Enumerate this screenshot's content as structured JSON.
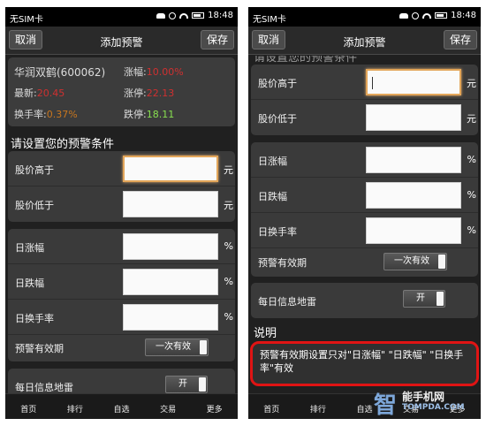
{
  "status_bar": {
    "carrier": "无SIM卡",
    "time": "18:48"
  },
  "header": {
    "cancel_label": "取消",
    "title": "添加预警",
    "save_label": "保存"
  },
  "quote": {
    "name": "华润双鹤(600062)",
    "change_pct_label": "涨幅:",
    "change_pct_value": "10.00%",
    "latest_label": "最新:",
    "latest_value": "20.45",
    "limit_up_label": "涨停:",
    "limit_up_value": "22.13",
    "turnover_label": "换手率:",
    "turnover_value": "0.37%",
    "limit_down_label": "跌停:",
    "limit_down_value": "18.11"
  },
  "conditions": {
    "section_title": "请设置您的预警条件",
    "partial_title": "请设置您的预警条件",
    "price_above": "股价高于",
    "price_below": "股价低于",
    "unit_yuan": "元",
    "daily_rise": "日涨幅",
    "daily_fall": "日跌幅",
    "daily_turnover": "日换手率",
    "unit_pct": "%",
    "validity_label": "预警有效期",
    "validity_value": "一次有效",
    "landmine_label": "每日信息地雷",
    "landmine_value": "开"
  },
  "note": {
    "title": "说明",
    "text": "预警有效期设置只对\"日涨幅\" \"日跌幅\" \"日换手率\"有效"
  },
  "bottom_nav": [
    "首页",
    "排行",
    "自选",
    "交易",
    "更多"
  ],
  "watermark": {
    "glyph": "智",
    "cn": "能手机网",
    "en": "TOMPDA.COM"
  }
}
